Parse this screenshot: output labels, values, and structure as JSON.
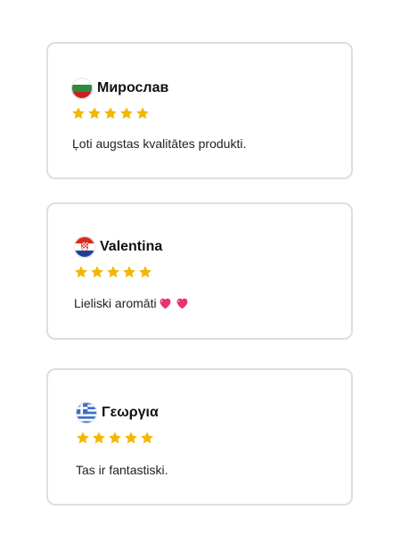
{
  "colors": {
    "card_border": "#dedede",
    "star": "#f2b705",
    "heart": "#e8336d"
  },
  "reviews": [
    {
      "name": "Мирослав",
      "flag_icon": "bulgaria-flag-icon",
      "rating": 5,
      "text": "Ļoti augstas kvalitātes produkti."
    },
    {
      "name": "Valentina",
      "flag_icon": "croatia-flag-icon",
      "rating": 5,
      "text": "Lieliski aromāti",
      "emoji": "💖 💖"
    },
    {
      "name": "Γεωργια",
      "flag_icon": "greece-flag-icon",
      "rating": 5,
      "text": "Tas ir fantastiski."
    }
  ]
}
